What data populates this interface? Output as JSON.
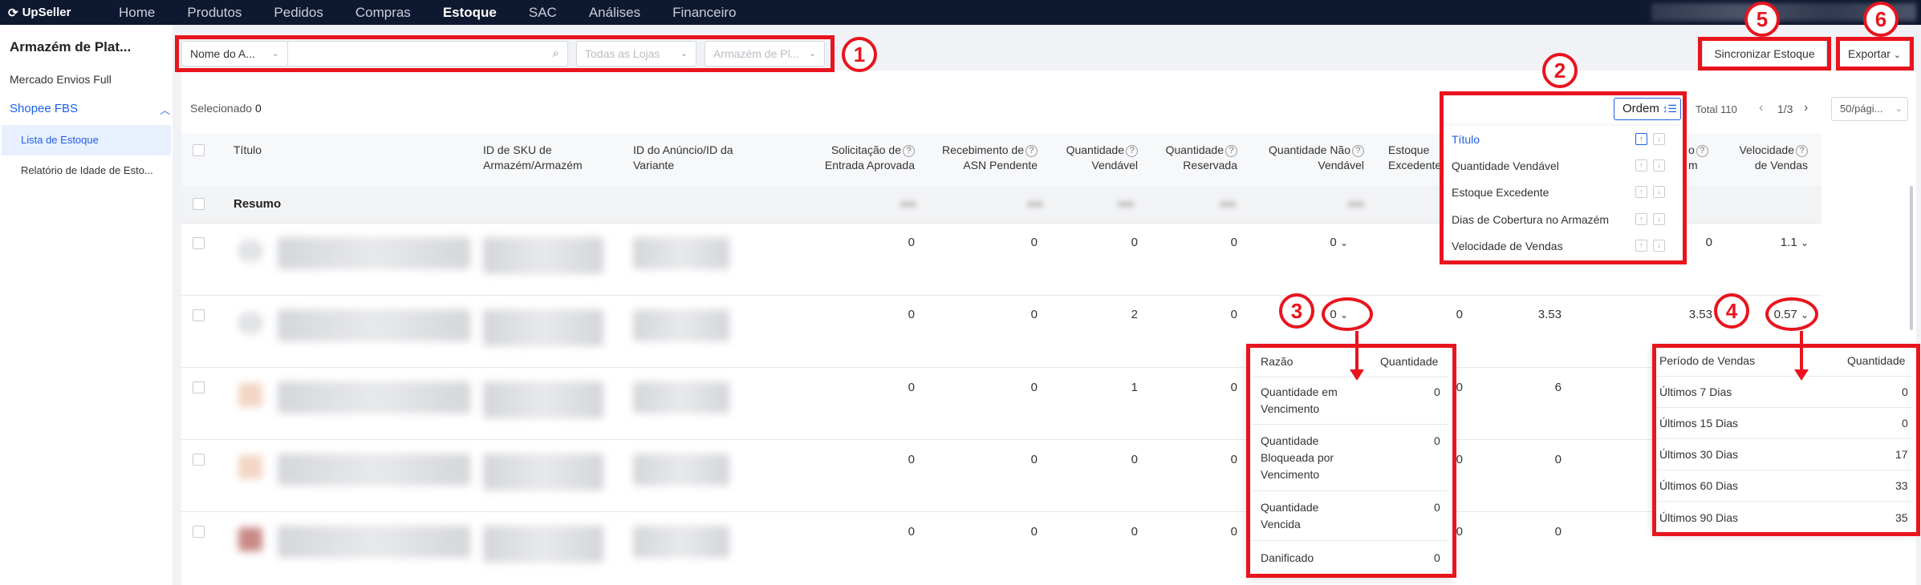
{
  "topnav": {
    "logo": "UpSeller",
    "items": [
      "Home",
      "Produtos",
      "Pedidos",
      "Compras",
      "Estoque",
      "SAC",
      "Análises",
      "Financeiro"
    ],
    "active": "Estoque"
  },
  "sidebar": {
    "title": "Armazém de Plat...",
    "items": [
      "Mercado Envios Full"
    ],
    "group": {
      "label": "Shopee FBS",
      "chevron": "^"
    },
    "subitems": [
      "Lista de Estoque",
      "Relatório de Idade de Esto..."
    ]
  },
  "filters": {
    "field_select": "Nome do A...",
    "search_value": "",
    "stores": "Todas as Lojas",
    "warehouse": "Armazém de Pl...",
    "sync_button": "Sincronizar Estoque",
    "export_button": "Exportar"
  },
  "toolbar": {
    "selected_label": "Selecionado",
    "selected_count": "0",
    "sort_button": "Ordem",
    "total": "Total 110",
    "page": "1/3",
    "page_size": "50/pági..."
  },
  "table": {
    "headers": [
      {
        "line1": "Título",
        "line2": ""
      },
      {
        "line1": "ID de SKU de",
        "line2": "Armazém/Armazém"
      },
      {
        "line1": "ID do Anúncio/ID da",
        "line2": "Variante"
      },
      {
        "line1": "Solicitação de",
        "line2": "Entrada Aprovada"
      },
      {
        "line1": "Recebimento de",
        "line2": "ASN Pendente"
      },
      {
        "line1": "Quantidade",
        "line2": "Vendável"
      },
      {
        "line1": "Quantidade",
        "line2": "Reservada"
      },
      {
        "line1": "Quantidade Não",
        "line2": "Vendável"
      },
      {
        "line1": "Estoque",
        "line2": "Excedente"
      },
      {
        "line1": "o",
        "line2": "m"
      },
      {
        "line1": "Velocidade",
        "line2": "de Vendas"
      }
    ],
    "summary_label": "Resumo",
    "rows": [
      {
        "entrada": "0",
        "asn": "0",
        "vendavel": "0",
        "reservada": "0",
        "nao_vendavel": "0",
        "excedente": "",
        "col_a": "",
        "col_b": "0",
        "velocidade": "1.1"
      },
      {
        "entrada": "0",
        "asn": "0",
        "vendavel": "2",
        "reservada": "0",
        "nao_vendavel": "0",
        "excedente": "0",
        "col_a": "3.53",
        "col_b": "3.53",
        "velocidade": "0.57"
      },
      {
        "entrada": "0",
        "asn": "0",
        "vendavel": "1",
        "reservada": "0",
        "nao_vendavel": "",
        "excedente": "0",
        "col_a": "6",
        "col_b": "",
        "velocidade": ""
      },
      {
        "entrada": "0",
        "asn": "0",
        "vendavel": "0",
        "reservada": "0",
        "nao_vendavel": "",
        "excedente": "0",
        "col_a": "0",
        "col_b": "",
        "velocidade": ""
      },
      {
        "entrada": "0",
        "asn": "0",
        "vendavel": "0",
        "reservada": "0",
        "nao_vendavel": "",
        "excedente": "0",
        "col_a": "0",
        "col_b": "",
        "velocidade": ""
      }
    ]
  },
  "sort_popup": {
    "items": [
      "Título",
      "Quantidade Vendável",
      "Estoque Excedente",
      "Dias de Cobertura no Armazém",
      "Velocidade de Vendas"
    ],
    "active": "Título"
  },
  "unsellable_popover": {
    "col1": "Razão",
    "col2": "Quantidade",
    "rows": [
      {
        "reason": [
          "Quantidade em",
          "Vencimento"
        ],
        "qty": "0"
      },
      {
        "reason": [
          "Quantidade",
          "Bloqueada por",
          "Vencimento"
        ],
        "qty": "0"
      },
      {
        "reason": [
          "Quantidade",
          "Vencida"
        ],
        "qty": "0"
      },
      {
        "reason": [
          "Danificado"
        ],
        "qty": "0"
      }
    ]
  },
  "sales_popover": {
    "col1": "Período de Vendas",
    "col2": "Quantidade",
    "rows": [
      {
        "period": "Últimos 7 Dias",
        "qty": "0"
      },
      {
        "period": "Últimos 15 Dias",
        "qty": "0"
      },
      {
        "period": "Últimos 30 Dias",
        "qty": "17"
      },
      {
        "period": "Últimos 60 Dias",
        "qty": "33"
      },
      {
        "period": "Últimos 90 Dias",
        "qty": "35"
      }
    ]
  },
  "annotations": [
    "1",
    "2",
    "3",
    "4",
    "5",
    "6"
  ],
  "colors": {
    "annotation": "#e8141e",
    "nav_bg": "#0e1830",
    "link": "#1d5fe6"
  },
  "icons": {
    "question": "?",
    "chevron": "⌄",
    "search": "⌕"
  }
}
